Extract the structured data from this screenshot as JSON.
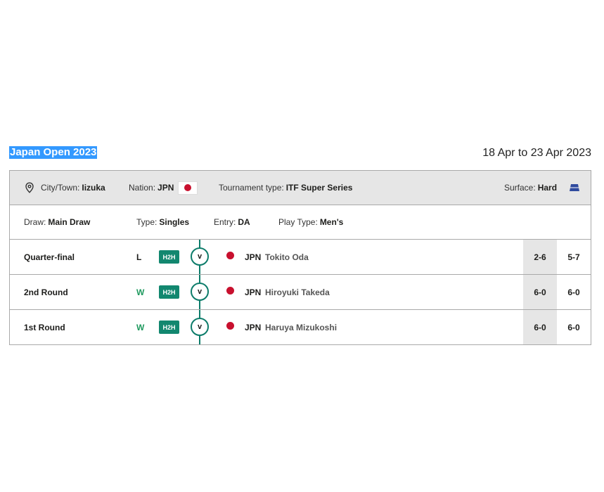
{
  "tournament": {
    "title": "Japan Open 2023",
    "dates": "18 Apr to 23 Apr 2023"
  },
  "info": {
    "city_label": "City/Town:",
    "city_value": "Iizuka",
    "nation_label": "Nation:",
    "nation_value": "JPN",
    "type_label": "Tournament type:",
    "type_value": "ITF Super Series",
    "surface_label": "Surface:",
    "surface_value": "Hard",
    "icons": {
      "location": "map-pin-icon",
      "flag": "japan-flag-icon",
      "surface": "hard-court-icon"
    }
  },
  "draw": {
    "draw_label": "Draw:",
    "draw_value": "Main Draw",
    "type_label": "Type:",
    "type_value": "Singles",
    "entry_label": "Entry:",
    "entry_value": "DA",
    "play_type_label": "Play Type:",
    "play_type_value": "Men's"
  },
  "matches": [
    {
      "round": "Quarter-final",
      "result": "L",
      "h2h": "H2H",
      "vs": "v",
      "opponent_nation": "JPN",
      "opponent_name": "Tokito Oda",
      "set1": "2-6",
      "set2": "5-7"
    },
    {
      "round": "2nd Round",
      "result": "W",
      "h2h": "H2H",
      "vs": "v",
      "opponent_nation": "JPN",
      "opponent_name": "Hiroyuki Takeda",
      "set1": "6-0",
      "set2": "6-0"
    },
    {
      "round": "1st Round",
      "result": "W",
      "h2h": "H2H",
      "vs": "v",
      "opponent_nation": "JPN",
      "opponent_name": "Haruya Mizukoshi",
      "set1": "6-0",
      "set2": "6-0"
    }
  ],
  "colors": {
    "win": "#1f9a5f",
    "loss": "#1d1d1b",
    "h2h_bg": "#12876f",
    "accent_line": "#0d7c6a",
    "flag_red": "#c8102e",
    "header_bg": "#e6e6e6",
    "surface_icon": "#2f4a9e"
  }
}
